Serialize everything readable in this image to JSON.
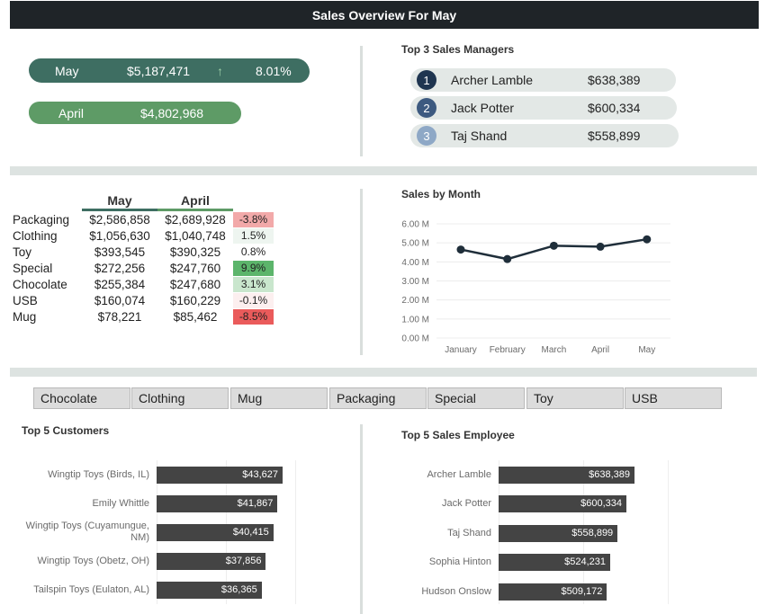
{
  "header": {
    "title": "Sales Overview For May"
  },
  "kpis": {
    "may": {
      "label": "May",
      "value": "$5,187,471",
      "arrow": "↑",
      "change": "8.01%"
    },
    "april": {
      "label": "April",
      "value": "$4,802,968"
    }
  },
  "managers": {
    "title": "Top 3 Sales Managers",
    "rows": [
      {
        "rank": "1",
        "name": "Archer Lamble",
        "value": "$638,389",
        "color": "#1f3550"
      },
      {
        "rank": "2",
        "name": "Jack Potter",
        "value": "$600,334",
        "color": "#3d5a80"
      },
      {
        "rank": "3",
        "name": "Taj Shand",
        "value": "$558,899",
        "color": "#8ea8c6"
      }
    ]
  },
  "categories": {
    "headers": {
      "may": "May",
      "april": "April"
    },
    "header_colors": {
      "may": "#3e6e62",
      "april": "#5e9b66"
    },
    "rows": [
      {
        "name": "Packaging",
        "may": "$2,586,858",
        "april": "$2,689,928",
        "change": "-3.8%",
        "color": "#f2a9a9"
      },
      {
        "name": "Clothing",
        "may": "$1,056,630",
        "april": "$1,040,748",
        "change": "1.5%",
        "color": "#eef5f0"
      },
      {
        "name": "Toy",
        "may": "$393,545",
        "april": "$390,325",
        "change": "0.8%",
        "color": "#ffffff"
      },
      {
        "name": "Special",
        "may": "$272,256",
        "april": "$247,760",
        "change": "9.9%",
        "color": "#5cb56b"
      },
      {
        "name": "Chocolate",
        "may": "$255,384",
        "april": "$247,680",
        "change": "3.1%",
        "color": "#c9e6cd"
      },
      {
        "name": "USB",
        "may": "$160,074",
        "april": "$160,229",
        "change": "-0.1%",
        "color": "#fcefef"
      },
      {
        "name": "Mug",
        "may": "$78,221",
        "april": "$85,462",
        "change": "-8.5%",
        "color": "#ea5b5b"
      }
    ]
  },
  "filters": [
    "Chocolate",
    "Clothing",
    "Mug",
    "Packaging",
    "Special",
    "Toy",
    "USB"
  ],
  "chart_data": [
    {
      "type": "line",
      "title": "Sales by Month",
      "x": [
        "January",
        "February",
        "March",
        "April",
        "May"
      ],
      "y_tick_labels": [
        "0.00 M",
        "1.00 M",
        "2.00 M",
        "3.00 M",
        "4.00 M",
        "5.00 M",
        "6.00 M"
      ],
      "ylim": [
        0,
        6000000
      ],
      "series": [
        {
          "values": [
            4650000,
            4150000,
            4850000,
            4800000,
            5187471
          ]
        }
      ],
      "line_color": "#1f2e3a",
      "grid": true
    },
    {
      "type": "bar",
      "orientation": "horizontal",
      "title": "Top 5 Customers",
      "categories": [
        "Wingtip Toys (Birds, IL)",
        "Emily Whittle",
        "Wingtip Toys (Cuyamungue, NM)",
        "Wingtip Toys (Obetz, OH)",
        "Tailspin Toys (Eulaton, AL)"
      ],
      "values": [
        43627,
        41867,
        40415,
        37856,
        36365
      ],
      "data_labels": [
        "$43,627",
        "$41,867",
        "$40,415",
        "$37,856",
        "$36,365"
      ],
      "xlim": [
        0,
        60000
      ],
      "bar_color": "#444444"
    },
    {
      "type": "bar",
      "orientation": "horizontal",
      "title": "Top 5 Sales Employee",
      "categories": [
        "Archer Lamble",
        "Jack Potter",
        "Taj Shand",
        "Sophia Hinton",
        "Hudson Onslow"
      ],
      "values": [
        638389,
        600334,
        558899,
        524231,
        509172
      ],
      "data_labels": [
        "$638,389",
        "$600,334",
        "$558,899",
        "$524,231",
        "$509,172"
      ],
      "xlim": [
        0,
        800000
      ],
      "bar_color": "#444444"
    }
  ]
}
